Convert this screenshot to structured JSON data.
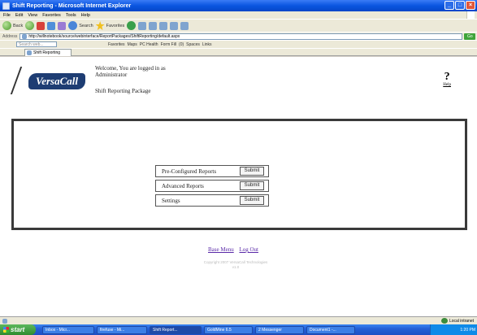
{
  "window": {
    "title": "Shift Reporting - Microsoft Internet Explorer"
  },
  "menubar": {
    "items": [
      "File",
      "Edit",
      "View",
      "Favorites",
      "Tools",
      "Help"
    ]
  },
  "toolbar": {
    "back": "Back",
    "search": "Search",
    "favorites": "Favorites"
  },
  "address": {
    "label": "Address",
    "url": "http://willnotebook/source/webinterface/ReportPackages/ShiftReporting/default.aspx",
    "go": "Go"
  },
  "links": {
    "search_placeholder": "Search web...",
    "items": [
      "Favorites",
      "Maps",
      "PC Health",
      "Form Fill",
      "(0)",
      "Spaces",
      "Links"
    ]
  },
  "tab": {
    "label": "Shift Reporting"
  },
  "page": {
    "logo_text": "VersaCall",
    "welcome_line1": "Welcome, You are logged in as",
    "welcome_line2": "Administrator",
    "package": "Shift Reporting Package",
    "help_symbol": "?",
    "help_label": "Help",
    "menu": [
      {
        "label": "Pre-Configured Reports",
        "button": "Submit"
      },
      {
        "label": "Advanced Reports",
        "button": "Submit"
      },
      {
        "label": "Settings",
        "button": "Submit"
      }
    ],
    "footer_links": [
      "Base Menu",
      "Log Out"
    ],
    "copyright_line1": "Copyright 2007 VersaCall Technologies",
    "copyright_line2": "v1.0"
  },
  "status": {
    "zone": "Local intranet"
  },
  "taskbar": {
    "start": "start",
    "items": [
      "Inbox - Micr...",
      "firefuse - Mi...",
      "Shift Report...",
      "GoldMine 6.5",
      "2 Messenger",
      "Document1 -..."
    ],
    "time": "1:20 PM"
  }
}
